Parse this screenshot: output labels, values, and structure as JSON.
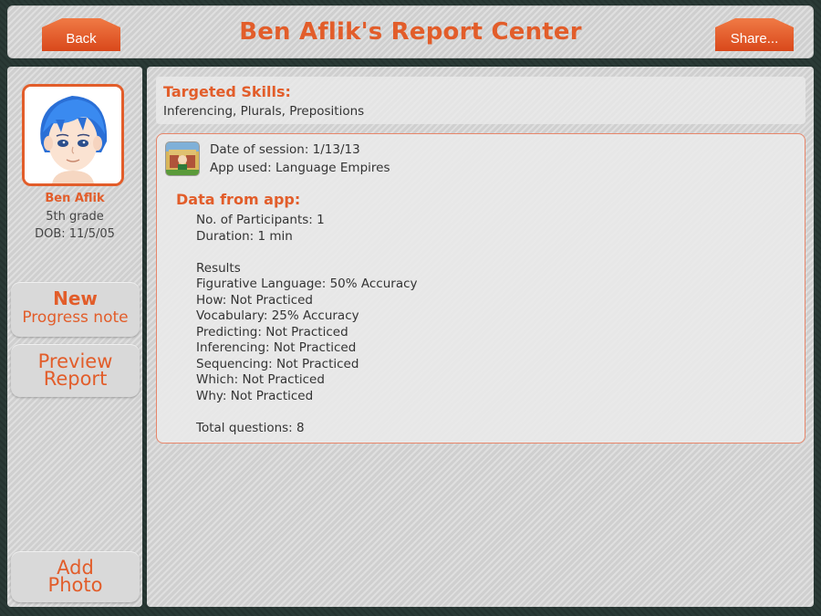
{
  "header": {
    "title": "Ben Aflik's Report Center",
    "back_label": "Back",
    "share_label": "Share..."
  },
  "student": {
    "name": "Ben Aflik",
    "grade": "5th grade",
    "dob": "DOB: 11/5/05"
  },
  "sidebar": {
    "new_label": "New",
    "progress_note_label": "Progress note",
    "preview_line1": "Preview",
    "preview_line2": "Report",
    "add_line1": "Add",
    "add_line2": "Photo"
  },
  "skills": {
    "heading": "Targeted Skills:",
    "list": "Inferencing, Plurals, Prepositions"
  },
  "session": {
    "date": "Date of session: 1/13/13",
    "app": "App used: Language Empires",
    "data_heading": "Data from app:",
    "participants": "No. of Participants: 1",
    "duration": "Duration: 1 min",
    "results_heading": "Results",
    "results": [
      "Figurative Language: 50% Accuracy",
      "How: Not Practiced",
      "Vocabulary: 25% Accuracy",
      "Predicting: Not Practiced",
      "Inferencing: Not Practiced",
      "Sequencing: Not Practiced",
      "Which: Not Practiced",
      "Why: Not Practiced"
    ],
    "total": "Total questions: 8"
  },
  "colors": {
    "accent": "#e25d2a",
    "panel": "#d6d6d6",
    "background": "#2a3a36"
  },
  "icons": {
    "avatar": "cartoon-boy-avatar",
    "app": "language-empires-app-icon"
  }
}
